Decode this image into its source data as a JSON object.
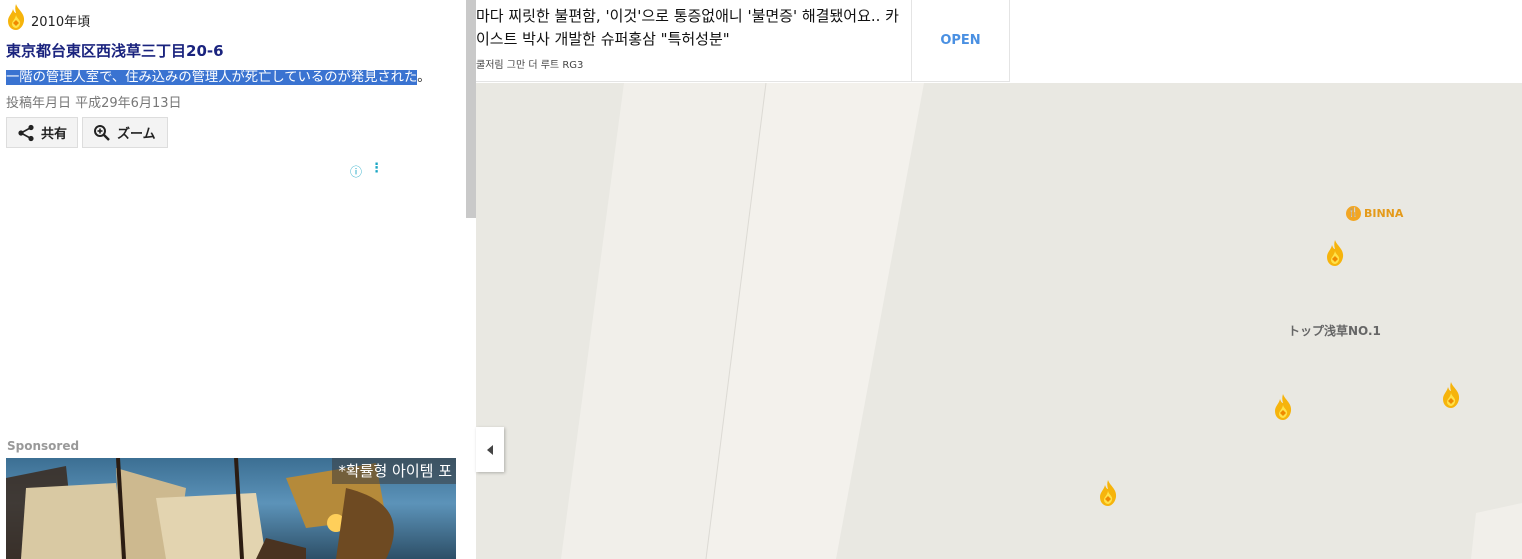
{
  "panel": {
    "era": "2010年頃",
    "address": "東京都台東区西浅草三丁目20-6",
    "description_highlighted": "一階の管理人室で、住み込みの管理人が死亡しているのが発見された",
    "description_tail": "。",
    "posted": "投稿年月日 平成29年6月13日",
    "share_label": "共有",
    "zoom_label": "ズーム",
    "ad_choices_icon": "info-icon",
    "sponsored_label": "Sponsored",
    "ad_caption": "*확률형 아이템 포"
  },
  "top_ad": {
    "text": "마다 찌릿한 불편함, '이것'으로 통증없애니 '불면증' 해결됐어요.. 카이스트 박사 개발한 슈퍼홍삼 \"특허성분\"",
    "source": "쿨저림 그만 더 루트 RG3",
    "open_label": "OPEN"
  },
  "map": {
    "pois": [
      {
        "label": "BINNA",
        "icon": "restaurant-icon",
        "color": "#f2a623"
      },
      {
        "label": "トップ浅草NO.1"
      }
    ],
    "marker_icon": "fire-icon",
    "marker_count": 4
  },
  "colors": {
    "address": "#1a237e",
    "highlight": "#3a73d1",
    "open_button": "#4a90e2",
    "map_background": "#e8e7e2"
  }
}
